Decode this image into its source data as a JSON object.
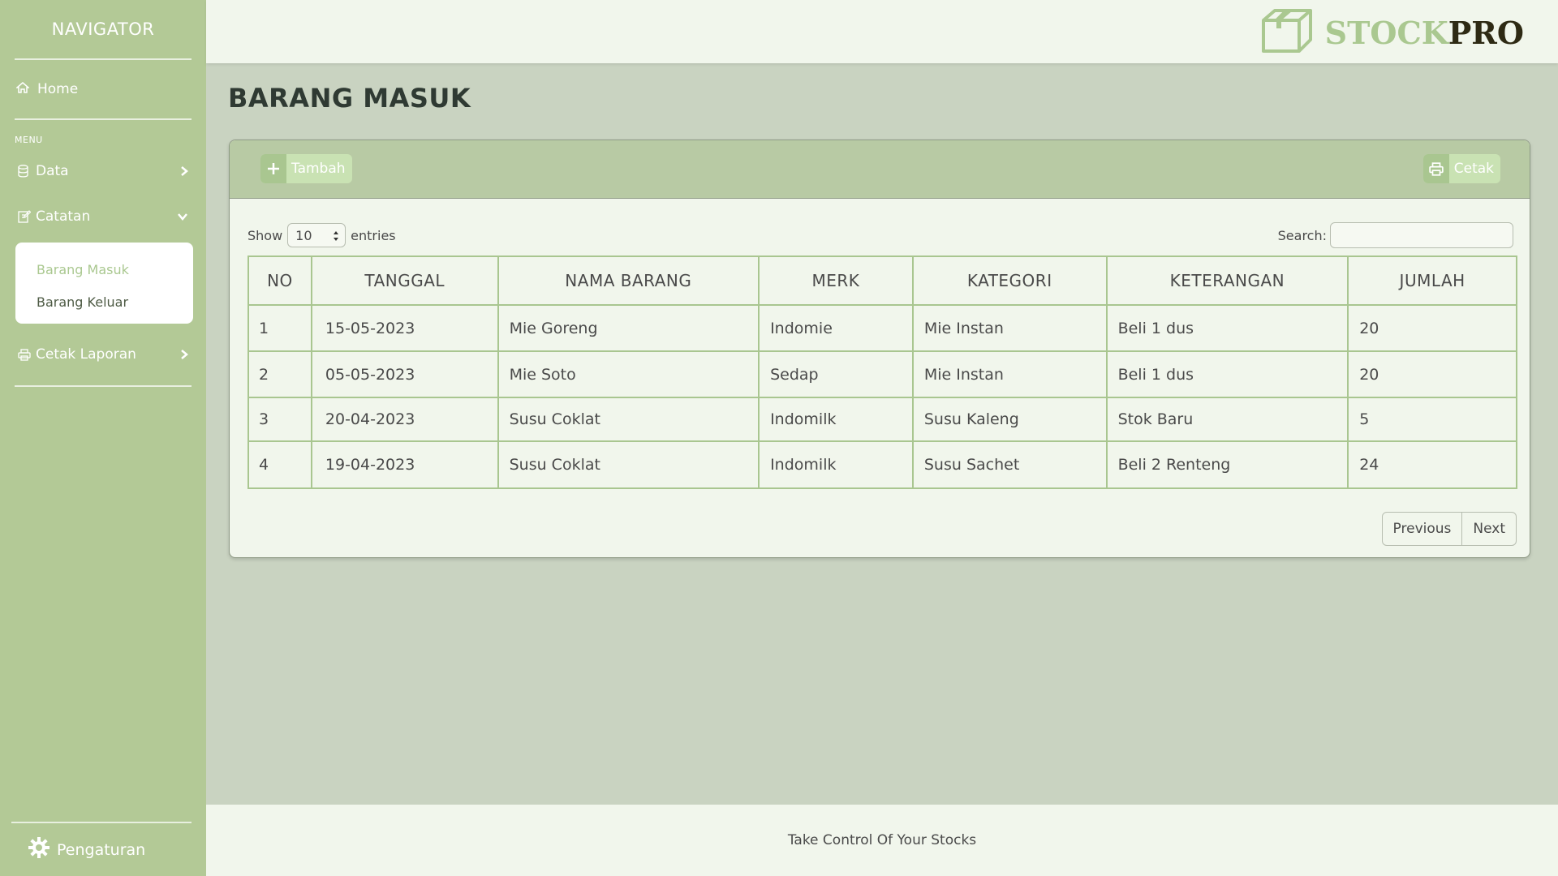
{
  "sidebar": {
    "title": "NAVIGATOR",
    "home_label": "Home",
    "menu_label": "MENU",
    "items": [
      {
        "label": "Data"
      },
      {
        "label": "Catatan"
      },
      {
        "label": "Cetak Laporan"
      }
    ],
    "catatan_sub": [
      "Barang Masuk",
      "Barang Keluar"
    ],
    "settings_label": "Pengaturan"
  },
  "brand": {
    "stock": "STOCK",
    "pro": "PRO"
  },
  "page": {
    "title": "BARANG MASUK"
  },
  "toolbar": {
    "add_label": "Tambah",
    "print_label": "Cetak"
  },
  "table_controls": {
    "show_label": "Show",
    "entries_value": "10",
    "entries_label": "entries",
    "search_label": "Search:"
  },
  "table": {
    "headers": [
      "NO",
      "TANGGAL",
      "NAMA BARANG",
      "MERK",
      "KATEGORI",
      "KETERANGAN",
      "JUMLAH"
    ],
    "rows": [
      [
        "1",
        "15-05-2023",
        "Mie Goreng",
        "Indomie",
        "Mie Instan",
        "Beli 1 dus",
        "20"
      ],
      [
        "2",
        "05-05-2023",
        "Mie Soto",
        "Sedap",
        "Mie Instan",
        "Beli 1 dus",
        "20"
      ],
      [
        "3",
        "20-04-2023",
        "Susu Coklat",
        "Indomilk",
        "Susu Kaleng",
        "Stok Baru",
        "5"
      ],
      [
        "4",
        "19-04-2023",
        "Susu Coklat",
        "Indomilk",
        "Susu Sachet",
        "Beli 2 Renteng",
        "24"
      ]
    ]
  },
  "pagination": {
    "previous": "Previous",
    "next": "Next"
  },
  "footer": {
    "text": "Take Control Of Your Stocks"
  },
  "colors": {
    "sidebar": "#b3c996",
    "accent": "#aac890",
    "background": "#c9d3c1",
    "surface": "#f1f6ec"
  }
}
